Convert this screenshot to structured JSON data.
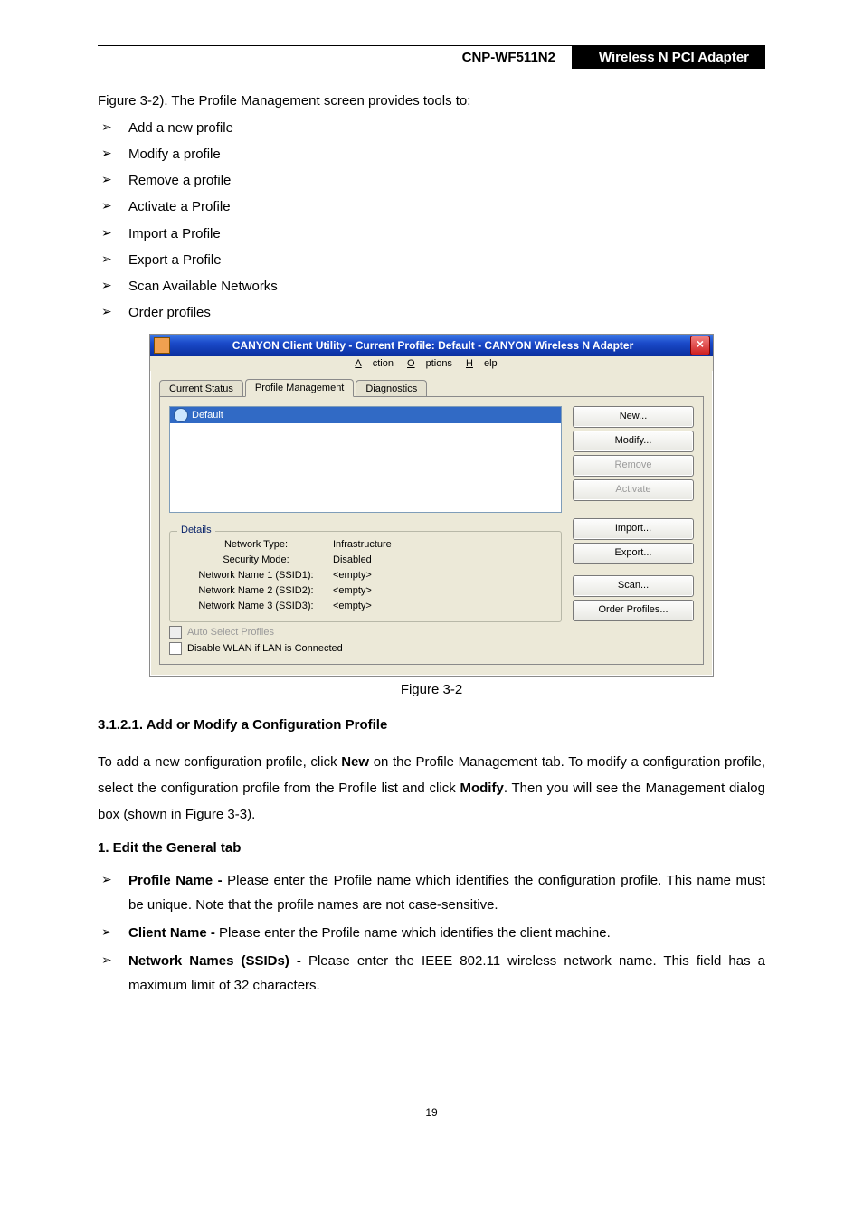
{
  "header": {
    "model": "CNP-WF511N2",
    "product": "Wireless N PCI Adapter"
  },
  "intro": "Figure 3-2). The Profile Management screen provides tools to:",
  "tools": [
    "Add a new profile",
    "Modify a profile",
    "Remove a profile",
    "Activate a Profile",
    "Import a Profile",
    "Export a Profile",
    "Scan Available Networks",
    "Order profiles"
  ],
  "window": {
    "title": "CANYON Client Utility - Current Profile: Default - CANYON Wireless N Adapter",
    "menu": {
      "action": "Action",
      "options": "Options",
      "help": "Help"
    },
    "tabs": {
      "t1": "Current Status",
      "t2": "Profile Management",
      "t3": "Diagnostics"
    },
    "profile_selected": "Default",
    "buttons": {
      "new": "New...",
      "modify": "Modify...",
      "remove": "Remove",
      "activate": "Activate",
      "import": "Import...",
      "export": "Export...",
      "scan": "Scan...",
      "order": "Order Profiles..."
    },
    "details": {
      "legend": "Details",
      "rows": {
        "r1k": "Network Type:",
        "r1v": "Infrastructure",
        "r2k": "Security Mode:",
        "r2v": "Disabled",
        "r3k": "Network Name 1 (SSID1):",
        "r3v": "<empty>",
        "r4k": "Network Name 2 (SSID2):",
        "r4v": "<empty>",
        "r5k": "Network Name 3 (SSID3):",
        "r5v": "<empty>"
      }
    },
    "checks": {
      "auto": "Auto Select Profiles",
      "disable": "Disable WLAN if LAN is Connected"
    }
  },
  "figure_caption": "Figure 3-2",
  "section_heading": "3.1.2.1.   Add or Modify a Configuration Profile",
  "para1_a": "To add a new configuration profile, click ",
  "para1_b": "New",
  "para1_c": " on the Profile Management tab. To modify a configuration profile, select the configuration profile from the Profile list and click ",
  "para1_d": "Modify",
  "para1_e": ". Then you will see the Management dialog box (shown in Figure 3-3).",
  "numbered_heading": "1.    Edit the General tab",
  "bullets2": {
    "b1_label": "Profile Name - ",
    "b1_text": "Please enter the Profile name which identifies the configuration profile. This name must be unique. Note that the profile names are not case-sensitive.",
    "b2_label": "Client Name - ",
    "b2_text": "Please enter the Profile name which identifies the client machine.",
    "b3_label": "Network Names (SSIDs) - ",
    "b3_text": "Please enter the IEEE 802.11 wireless network name. This field has a maximum limit of 32 characters."
  },
  "page_number": "19"
}
